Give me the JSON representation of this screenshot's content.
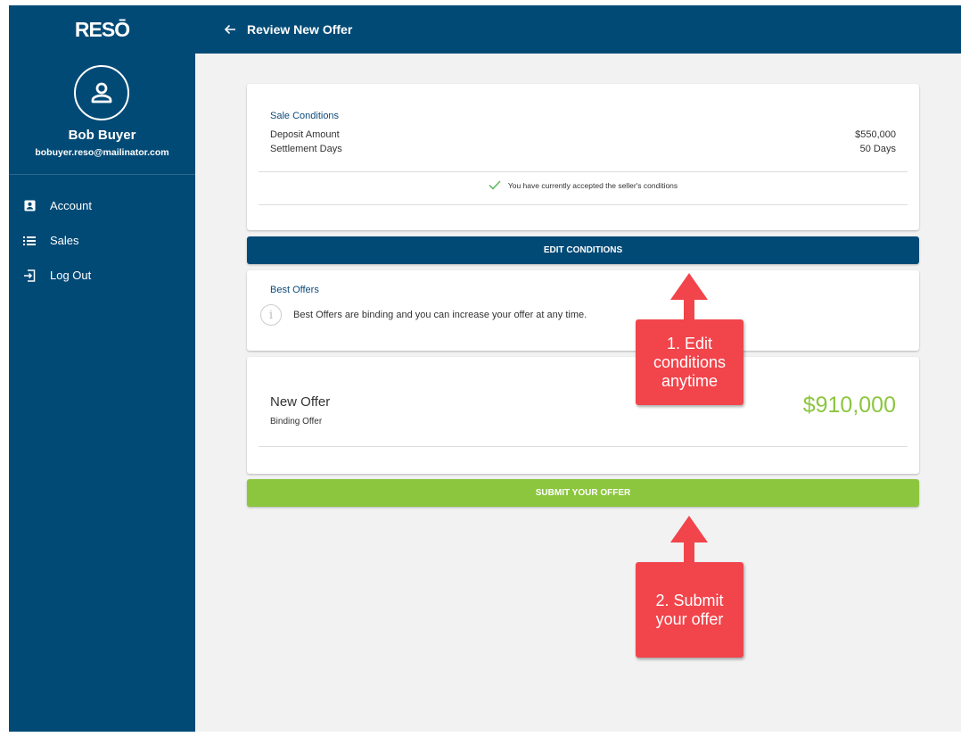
{
  "brand": {
    "logo": "RESŌ"
  },
  "user": {
    "name": "Bob Buyer",
    "email": "bobuyer.reso@mailinator.com"
  },
  "sidebar": {
    "items": [
      {
        "label": "Account",
        "icon": "account-box-icon"
      },
      {
        "label": "Sales",
        "icon": "list-icon"
      },
      {
        "label": "Log Out",
        "icon": "logout-icon"
      }
    ]
  },
  "header": {
    "title": "Review New Offer",
    "back_icon": "arrow-left-icon"
  },
  "conditions": {
    "heading": "Sale Conditions",
    "rows": [
      {
        "label": "Deposit Amount",
        "value": "$550,000"
      },
      {
        "label": "Settlement Days",
        "value": "50 Days"
      }
    ],
    "accepted_text": "You have currently accepted the seller's conditions"
  },
  "edit_button": "EDIT CONDITIONS",
  "best_offers": {
    "heading": "Best Offers",
    "info_text": "Best Offers are binding and you can increase your offer at any time."
  },
  "offer": {
    "title": "New Offer",
    "subtitle": "Binding Offer",
    "amount": "$910,000"
  },
  "submit_button": "SUBMIT YOUR OFFER",
  "callouts": {
    "first": [
      "1. Edit",
      "conditions",
      "anytime"
    ],
    "second": [
      "2. Submit",
      "your offer"
    ]
  },
  "colors": {
    "primary": "#024a76",
    "accent_green": "#8cc63f",
    "callout_red": "#f2444b",
    "background": "#f2f2f2"
  }
}
